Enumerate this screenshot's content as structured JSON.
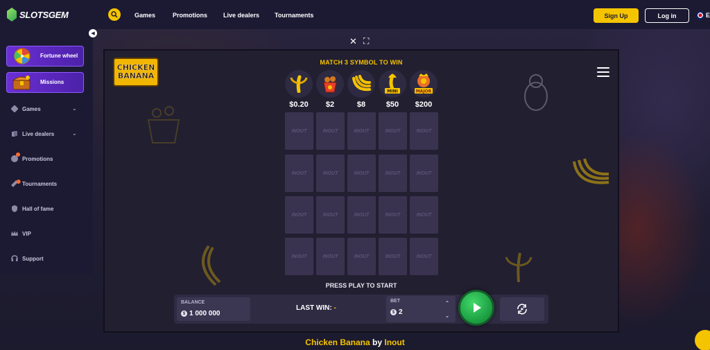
{
  "brand": {
    "name": "SLOTSGEM"
  },
  "nav": {
    "links": [
      "Games",
      "Promotions",
      "Live dealers",
      "Tournaments"
    ],
    "signup": "Sign Up",
    "login": "Log in",
    "lang": "E"
  },
  "sidebar": {
    "promo_cards": [
      {
        "label": "Fortune wheel",
        "icon": "fortune-wheel-icon"
      },
      {
        "label": "Missions",
        "icon": "treasure-chest-icon"
      }
    ],
    "items": [
      {
        "label": "Games",
        "icon": "gamepad-icon",
        "has_chevron": true
      },
      {
        "label": "Live dealers",
        "icon": "cards-icon",
        "has_chevron": true
      },
      {
        "label": "Promotions",
        "icon": "gift-icon",
        "badge": true
      },
      {
        "label": "Tournaments",
        "icon": "trophy-icon",
        "badge": true
      },
      {
        "label": "Hall of fame",
        "icon": "shield-icon"
      },
      {
        "label": "VIP",
        "icon": "crown-icon"
      },
      {
        "label": "Support",
        "icon": "headset-icon"
      }
    ]
  },
  "game": {
    "logo_line1": "CHICKEN",
    "logo_line2": "BANANA",
    "match_text": "MATCH 3 SYMBOL TO WIN",
    "symbols": [
      {
        "icon": "banana-icon",
        "value": "$0.20"
      },
      {
        "icon": "chicken-bucket-icon",
        "value": "$2"
      },
      {
        "icon": "banana-bunch-icon",
        "value": "$8"
      },
      {
        "icon": "mini-jackpot-icon",
        "value": "$50",
        "tag": "MINI"
      },
      {
        "icon": "major-jackpot-icon",
        "value": "$200",
        "tag": "MAJOR"
      }
    ],
    "cell_text": "INOUT",
    "press_text": "PRESS PLAY TO START",
    "balance_label": "BALANCE",
    "balance_value": "1 000 000",
    "currency": "$",
    "last_win_label": "LAST WIN:",
    "last_win_value": "-",
    "bet_label": "BET",
    "bet_value": "2"
  },
  "caption": {
    "game": "Chicken Banana",
    "by": "by",
    "provider": "Inout"
  },
  "colors": {
    "accent": "#f5c400",
    "sidebar_bg": "#1c1a33",
    "promo_purple": "#6b2fd6",
    "play_green": "#1a9a3f"
  }
}
